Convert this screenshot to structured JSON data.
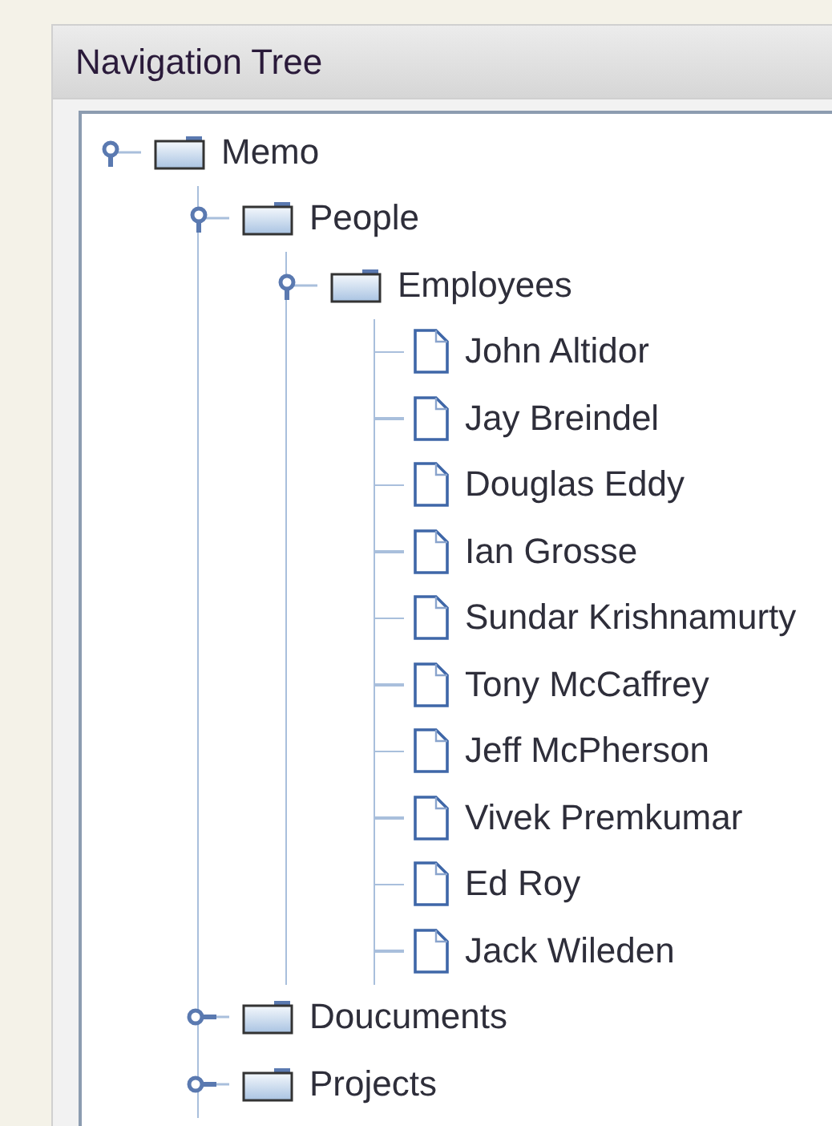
{
  "panel": {
    "title": "Navigation Tree"
  },
  "tree": [
    {
      "label": "Memo",
      "kind": "folder",
      "expanded": true,
      "children": [
        {
          "label": "People",
          "kind": "folder",
          "expanded": true,
          "children": [
            {
              "label": "Employees",
              "kind": "folder",
              "expanded": true,
              "children": [
                {
                  "label": "John Altidor",
                  "kind": "document"
                },
                {
                  "label": "Jay Breindel",
                  "kind": "document"
                },
                {
                  "label": "Douglas Eddy",
                  "kind": "document"
                },
                {
                  "label": "Ian Grosse",
                  "kind": "document"
                },
                {
                  "label": "Sundar Krishnamurty",
                  "kind": "document"
                },
                {
                  "label": "Tony McCaffrey",
                  "kind": "document"
                },
                {
                  "label": "Jeff McPherson",
                  "kind": "document"
                },
                {
                  "label": "Vivek Premkumar",
                  "kind": "document"
                },
                {
                  "label": "Ed Roy",
                  "kind": "document"
                },
                {
                  "label": "Jack Wileden",
                  "kind": "document"
                }
              ]
            }
          ]
        },
        {
          "label": "Doucuments",
          "kind": "folder",
          "expanded": false
        },
        {
          "label": "Projects",
          "kind": "folder",
          "expanded": false
        }
      ]
    }
  ]
}
